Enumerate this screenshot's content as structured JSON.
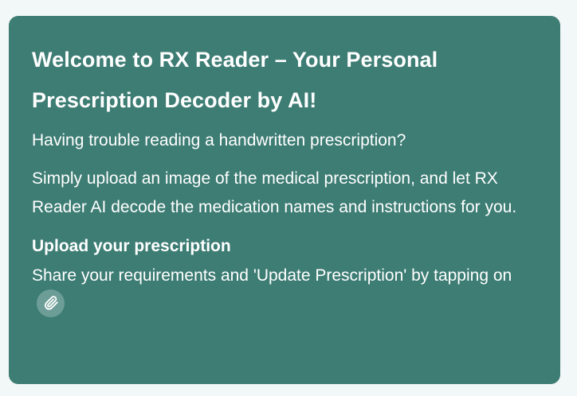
{
  "card": {
    "title": "Welcome to RX Reader – Your Personal Prescription Decoder by AI!",
    "intro_question": "Having trouble reading a handwritten prescription?",
    "intro_body": "Simply upload an image of the medical prescription, and let RX Reader AI decode the medication names and instructions for you.",
    "upload_heading": "Upload your prescription",
    "upload_text": "Share your requirements and 'Update Prescription' by tapping on",
    "attach_icon": "paperclip-icon"
  },
  "colors": {
    "card_background": "#3d7d74",
    "page_background": "#f2f7f7",
    "text": "#ffffff"
  }
}
